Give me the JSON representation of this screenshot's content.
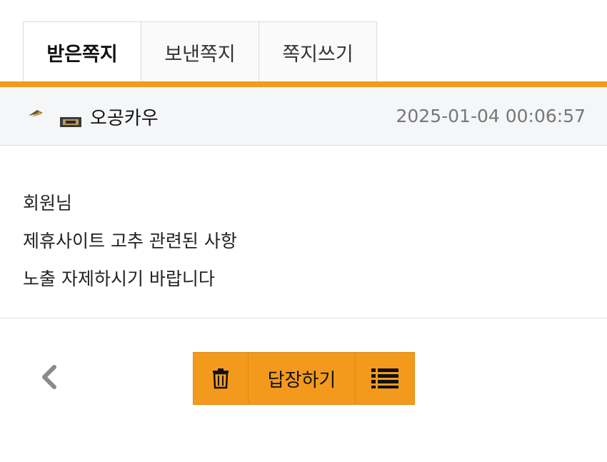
{
  "tabs": [
    {
      "label": "받은쪽지",
      "active": true
    },
    {
      "label": "보낸쪽지",
      "active": false
    },
    {
      "label": "쪽지쓰기",
      "active": false
    }
  ],
  "message": {
    "sender_icon": "level-badge-icon",
    "sender": "오공카우",
    "date": "2025-01-04 00:06:57",
    "lines": [
      "회원님",
      "제휴사이트 고추 관련된 사항",
      "노출 자제하시기 바랍니다"
    ]
  },
  "actions": {
    "back_icon": "chevron-left-icon",
    "delete_icon": "trash-icon",
    "reply_label": "답장하기",
    "list_icon": "list-icon"
  },
  "colors": {
    "accent": "#f29a1e",
    "header_bg": "#f5f6f8",
    "date_text": "#777777"
  }
}
